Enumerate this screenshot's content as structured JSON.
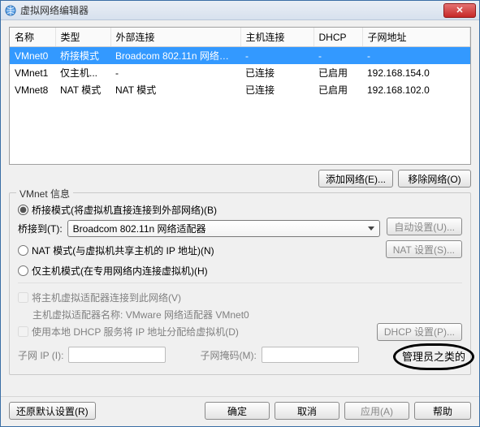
{
  "window": {
    "title": "虚拟网络编辑器"
  },
  "close_glyph": "✕",
  "table": {
    "cols": [
      "名称",
      "类型",
      "外部连接",
      "主机连接",
      "DHCP",
      "子网地址"
    ],
    "rows": [
      {
        "name": "VMnet0",
        "type": "桥接模式",
        "ext": "Broadcom 802.11n 网络适...",
        "host": "-",
        "dhcp": "-",
        "subnet": "-",
        "selected": true
      },
      {
        "name": "VMnet1",
        "type": "仅主机...",
        "ext": "-",
        "host": "已连接",
        "dhcp": "已启用",
        "subnet": "192.168.154.0"
      },
      {
        "name": "VMnet8",
        "type": "NAT 模式",
        "ext": "NAT 模式",
        "host": "已连接",
        "dhcp": "已启用",
        "subnet": "192.168.102.0"
      }
    ]
  },
  "buttons": {
    "add_net": "添加网络(E)...",
    "remove_net": "移除网络(O)",
    "restore": "还原默认设置(R)",
    "ok": "确定",
    "cancel": "取消",
    "apply": "应用(A)",
    "help": "帮助"
  },
  "group": {
    "title": "VMnet 信息",
    "opt_bridge": "桥接模式(将虚拟机直接连接到外部网络)(B)",
    "bridge_to_label": "桥接到(T):",
    "bridge_combo": "Broadcom 802.11n 网络适配器",
    "auto_btn": "自动设置(U)...",
    "opt_nat": "NAT 模式(与虚拟机共享主机的 IP 地址)(N)",
    "nat_btn": "NAT 设置(S)...",
    "opt_host": "仅主机模式(在专用网络内连接虚拟机)(H)",
    "chk_host_adapter": "将主机虚拟适配器连接到此网络(V)",
    "host_adapter_name_label": "主机虚拟适配器名称:",
    "host_adapter_name_value": "VMware 网络适配器 VMnet0",
    "chk_dhcp": "使用本地 DHCP 服务将 IP 地址分配给虚拟机(D)",
    "dhcp_btn": "DHCP 设置(P)...",
    "subnet_ip_label": "子网 IP (I):",
    "subnet_mask_label": "子网掩码(M):"
  },
  "annotation": "管理员之类的"
}
